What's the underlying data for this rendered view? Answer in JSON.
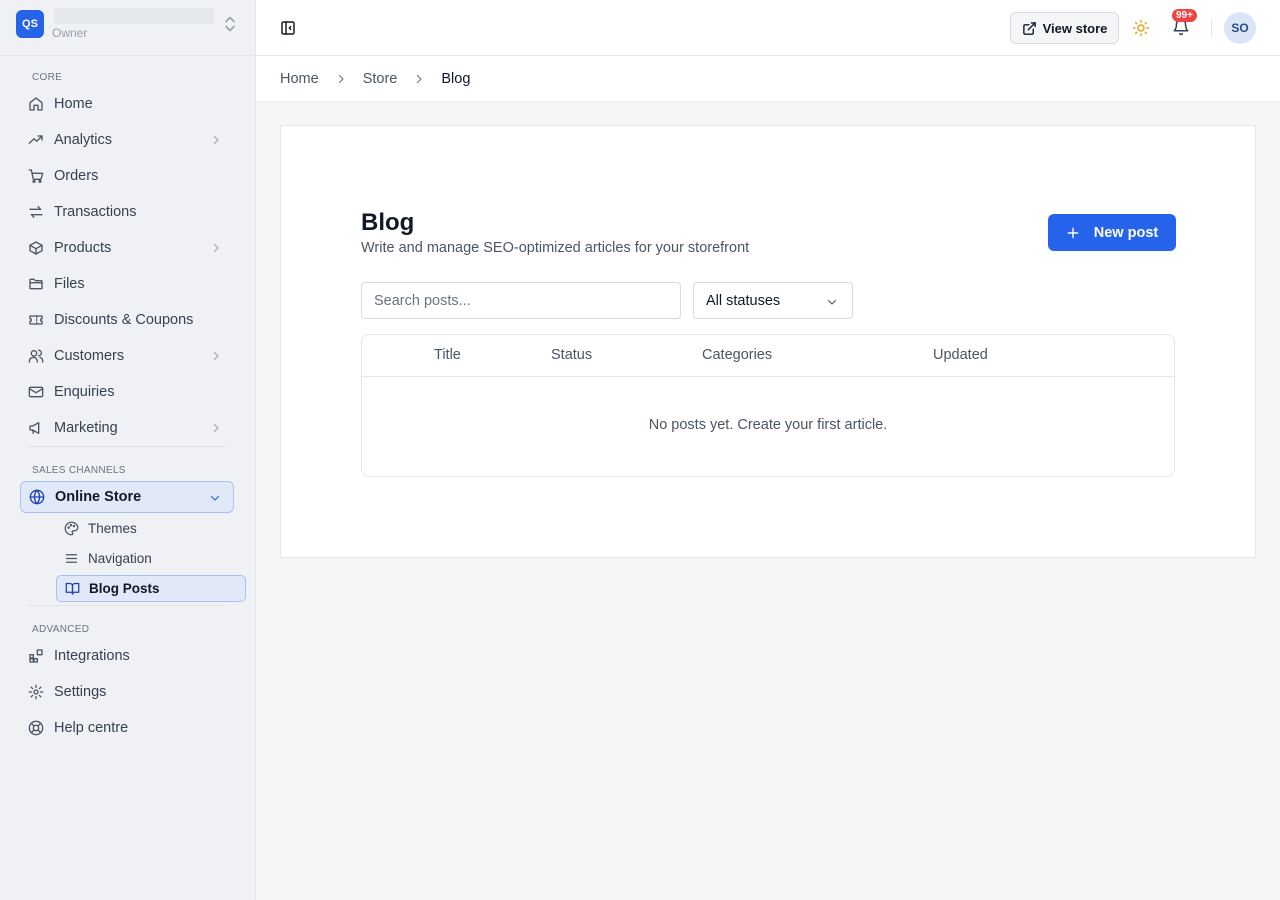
{
  "workspace": {
    "logo": "QS",
    "role": "Owner"
  },
  "sidebar": {
    "sections": {
      "core": "CORE",
      "sales": "SALES CHANNELS",
      "advanced": "ADVANCED"
    },
    "core_items": [
      {
        "label": "Home",
        "icon": "home-icon"
      },
      {
        "label": "Analytics",
        "icon": "trending-up-icon"
      },
      {
        "label": "Orders",
        "icon": "cart-icon"
      },
      {
        "label": "Transactions",
        "icon": "swap-icon"
      },
      {
        "label": "Products",
        "icon": "box-icon"
      },
      {
        "label": "Files",
        "icon": "folder-icon"
      },
      {
        "label": "Discounts & Coupons",
        "icon": "ticket-icon"
      },
      {
        "label": "Customers",
        "icon": "users-icon"
      },
      {
        "label": "Enquiries",
        "icon": "mail-icon"
      },
      {
        "label": "Marketing",
        "icon": "megaphone-icon"
      }
    ],
    "online_store": {
      "label": "Online Store",
      "icon": "globe-icon"
    },
    "online_store_sub": [
      {
        "label": "Themes",
        "icon": "palette-icon"
      },
      {
        "label": "Navigation",
        "icon": "menu-icon"
      },
      {
        "label": "Blog Posts",
        "icon": "book-icon"
      }
    ],
    "advanced_items": [
      {
        "label": "Integrations",
        "icon": "blocks-icon"
      },
      {
        "label": "Settings",
        "icon": "gear-icon"
      },
      {
        "label": "Help centre",
        "icon": "lifebuoy-icon"
      }
    ]
  },
  "topbar": {
    "view_store": "View store",
    "notifications_badge": "99+",
    "avatar": "SO"
  },
  "breadcrumb": {
    "items": [
      "Home",
      "Store",
      "Blog"
    ]
  },
  "page": {
    "title": "Blog",
    "subtitle": "Write and manage SEO-optimized articles for your storefront",
    "new_post": "New post",
    "search_placeholder": "Search posts...",
    "status_filter": "All statuses",
    "table": {
      "columns": [
        "Title",
        "Status",
        "Categories",
        "Updated"
      ],
      "empty": "No posts yet. Create your first article."
    }
  },
  "colors": {
    "accent": "#2563eb",
    "badge": "#ef4444",
    "sun": "#e8a317"
  }
}
